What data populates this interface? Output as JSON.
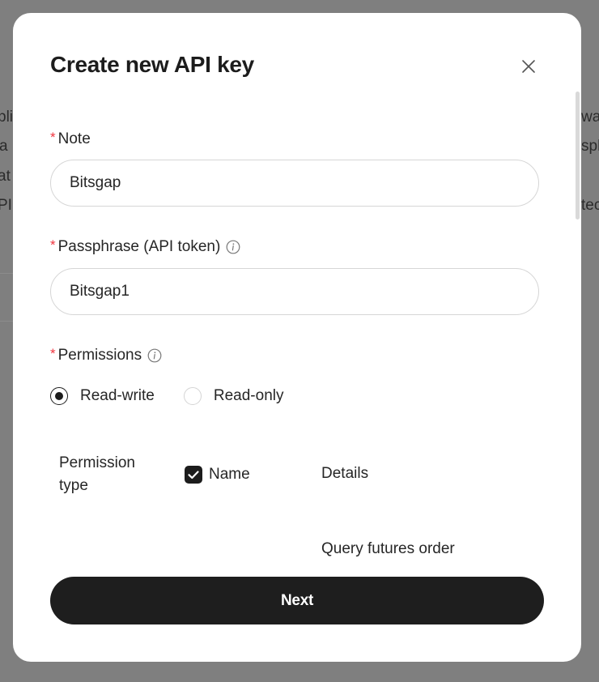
{
  "background": {
    "left_fragments": [
      "pli",
      "a",
      "at",
      "PI"
    ],
    "right_fragments": [
      "wa",
      "sph",
      "",
      "tec"
    ]
  },
  "modal": {
    "title": "Create new API key",
    "close_icon": "close-icon",
    "required_mark": "*",
    "note": {
      "label": "Note",
      "value": "Bitsgap"
    },
    "passphrase": {
      "label": "Passphrase (API token)",
      "value": "Bitsgap1",
      "info_icon": "info-icon"
    },
    "permissions": {
      "label": "Permissions",
      "info_icon": "info-icon",
      "options": [
        {
          "label": "Read-write",
          "selected": true
        },
        {
          "label": "Read-only",
          "selected": false
        }
      ]
    },
    "table": {
      "col_type": "Permission type",
      "col_name": "Name",
      "col_name_checked": true,
      "col_details": "Details",
      "row_details": "Query futures order"
    },
    "next_label": "Next"
  },
  "colors": {
    "required": "#f0343e",
    "primary": "#1e1e1e",
    "backdrop": "#7f7f7f"
  }
}
